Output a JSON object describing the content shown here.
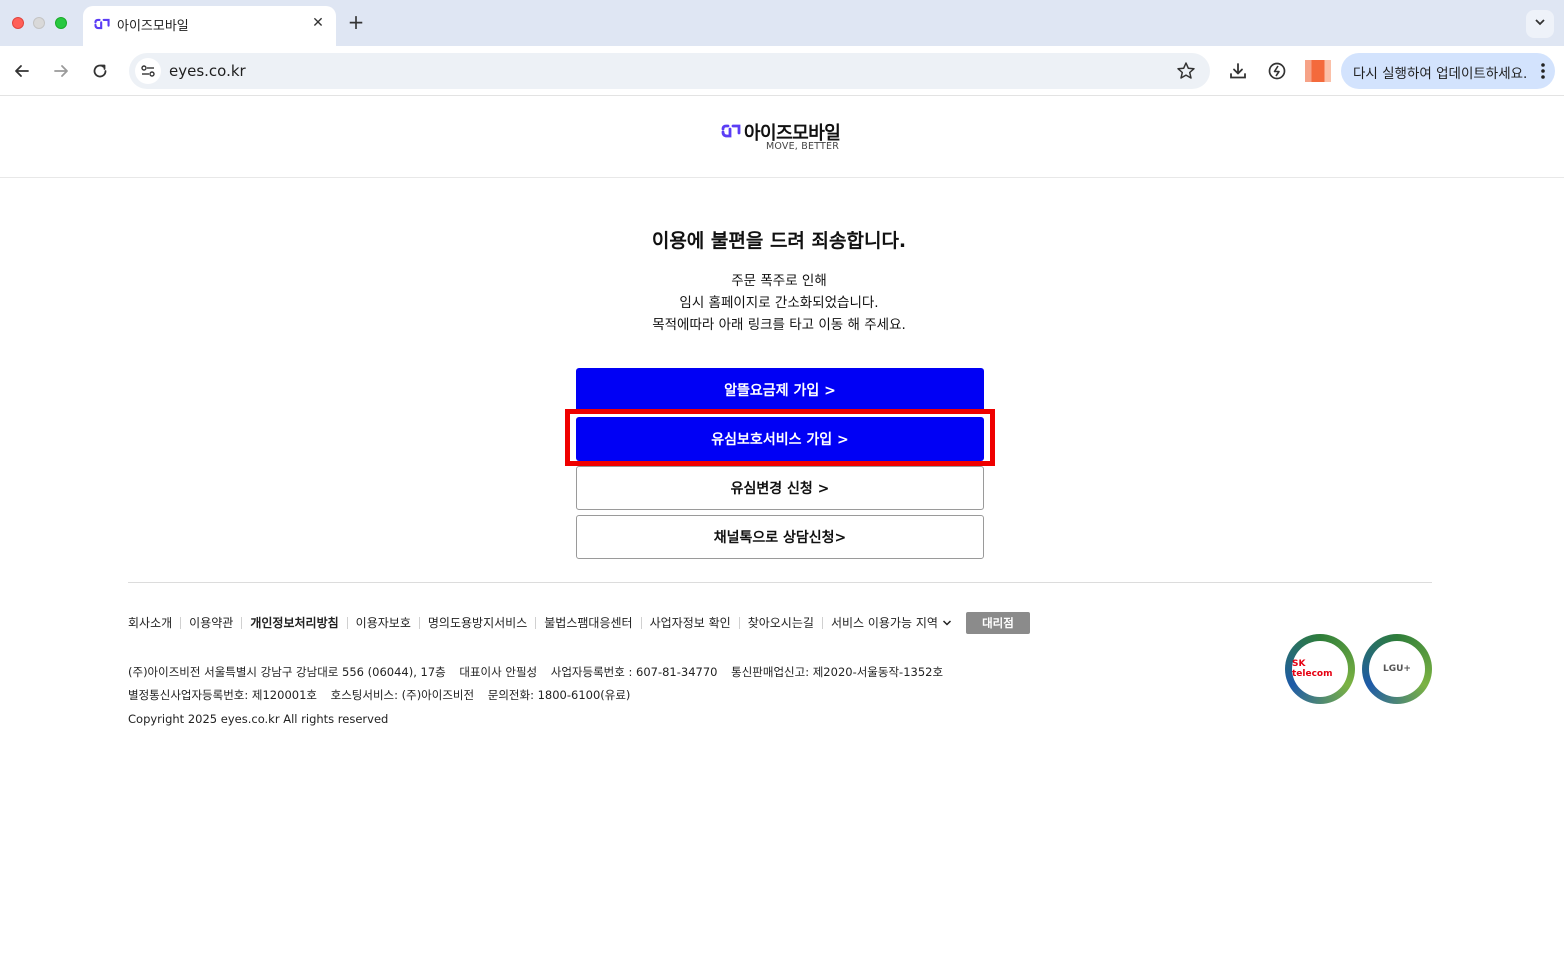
{
  "browser": {
    "tab_title": "아이즈모바일",
    "tab_close": "✕",
    "new_tab": "+",
    "url": "eyes.co.kr",
    "update_label": "다시 실행하여 업데이트하세요."
  },
  "header": {
    "logo_text": "아이즈모바일",
    "logo_tagline": "MOVE, BETTER",
    "logo_color": "#5b3df5"
  },
  "notice": {
    "title": "이용에 불편을 드려 죄송합니다.",
    "lines": [
      "주문 폭주로 인해",
      "임시 홈페이지로 간소화되었습니다.",
      "목적에따라 아래 링크를 타고 이동 해 주세요."
    ]
  },
  "actions": {
    "plan_signup": "알뜰요금제 가입 >",
    "usim_protect": "유심보호서비스 가입 >",
    "usim_change": "유심변경 신청 >",
    "channel_talk": "채널톡으로 상담신청>"
  },
  "footer": {
    "links": [
      "회사소개",
      "이용약관",
      "개인정보처리방침",
      "이용자보호",
      "명의도용방지서비스",
      "불법스팸대응센터",
      "사업자정보 확인",
      "찾아오시는길"
    ],
    "region_label": "서비스 이용가능 지역",
    "dealer_label": "대리점",
    "info_line1": [
      "(주)아이즈비전 서울특별시 강남구 강남대로 556 (06044), 17층",
      "대표이사 안필성",
      "사업자등록번호 : 607-81-34770",
      "통신판매업신고: 제2020-서울동작-1352호"
    ],
    "info_line2": [
      "별정통신사업자등록번호: 제120001호",
      "호스팅서비스: (주)아이즈비전",
      "문의전화: 1800-6100(유료)"
    ],
    "copyright": "Copyright 2025 eyes.co.kr All rights reserved",
    "badges": [
      "SK telecom",
      "LGU+"
    ]
  },
  "colors": {
    "primary_button": "#0000f5",
    "highlight": "#ef0000"
  }
}
